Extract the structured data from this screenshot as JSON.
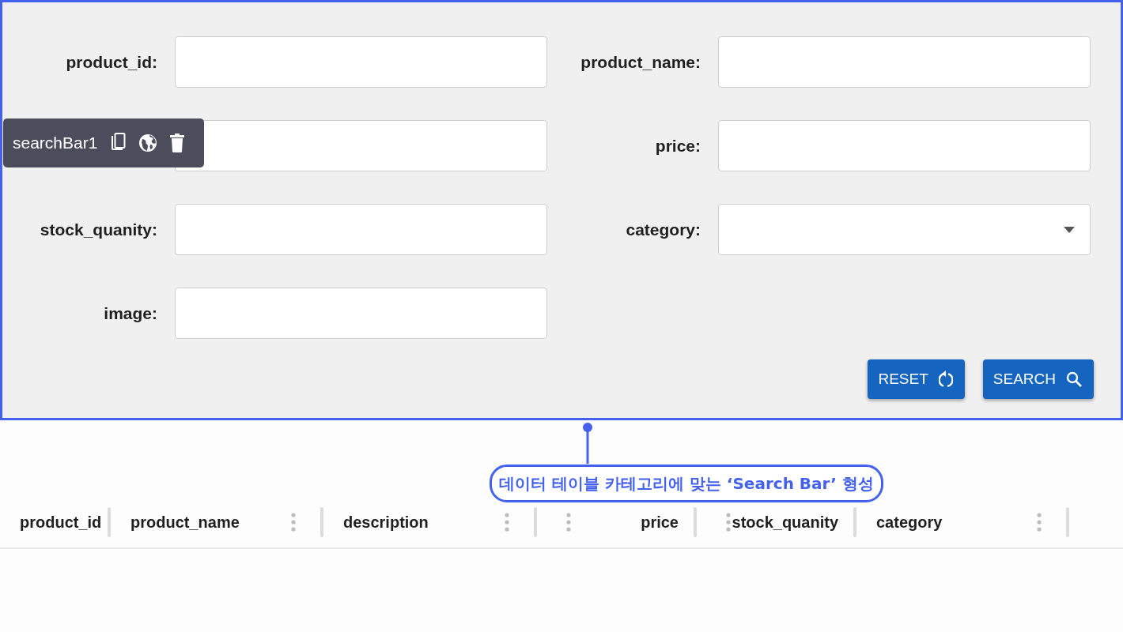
{
  "editor_toolbar": {
    "component_name": "searchBar1"
  },
  "search_form": {
    "fields": [
      {
        "label": "product_id:",
        "kind": "text"
      },
      {
        "label": "product_name:",
        "kind": "text"
      },
      {
        "kind": "text"
      },
      {
        "label": "price:",
        "kind": "text"
      },
      {
        "label": "stock_quanity:",
        "kind": "text"
      },
      {
        "label": "category:",
        "kind": "select"
      },
      {
        "label": "image:",
        "kind": "text"
      }
    ],
    "buttons": [
      {
        "label": "RESET",
        "kind": "reset"
      },
      {
        "label": "SEARCH",
        "kind": "search"
      }
    ]
  },
  "annotation": {
    "text": "데이터 테이블 카테고리에 맞는 ‘Search Bar’ 형성"
  },
  "table": {
    "columns": [
      {
        "title": "product_id",
        "kind": "text",
        "menu": false
      },
      {
        "title": "product_name",
        "kind": "text",
        "menu": true
      },
      {
        "title": "description",
        "kind": "text",
        "menu": true
      },
      {
        "title": "price",
        "kind": "number",
        "menu": true
      },
      {
        "title": "stock_quanity",
        "kind": "number",
        "menu": true
      },
      {
        "title": "category",
        "kind": "text",
        "menu": true
      }
    ]
  }
}
